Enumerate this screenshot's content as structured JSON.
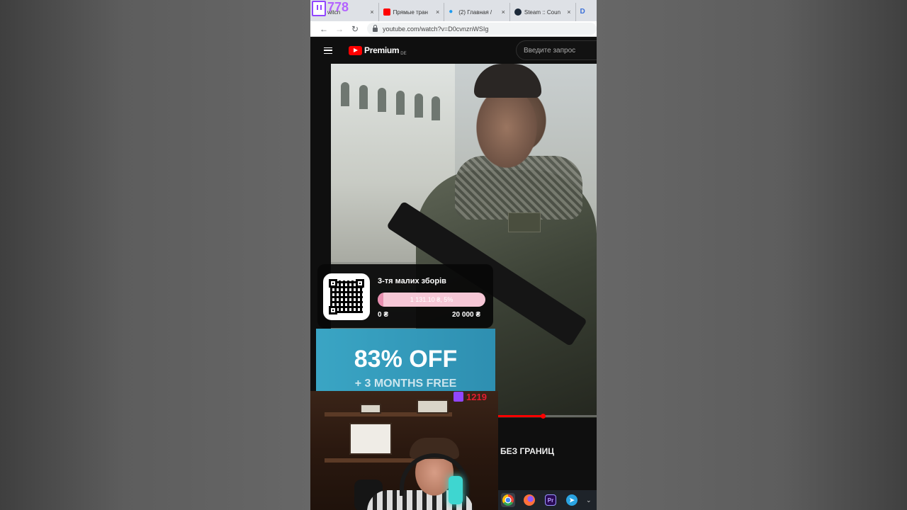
{
  "twitch_overlay": {
    "follower_count": "778"
  },
  "browser": {
    "tabs": [
      {
        "label": "witch",
        "favicon": "twitch-icon",
        "active": false
      },
      {
        "label": "Прямые тран",
        "favicon": "youtube-icon",
        "active": false
      },
      {
        "label": "(2) Главная /",
        "favicon": "twitter-icon",
        "active": false
      },
      {
        "label": "Steam :: Coun",
        "favicon": "steam-icon",
        "active": false
      },
      {
        "label": "D",
        "favicon": "d-icon",
        "active": false
      }
    ],
    "tab_close_glyph": "×",
    "url": "youtube.com/watch?v=D0cvnznWSIg"
  },
  "youtube": {
    "brand": "Premium",
    "country_code": "DE",
    "search_placeholder": "Введите запрос",
    "progress_fraction": 0.45,
    "caption": "БЕЗ ГРАНИЦ"
  },
  "donation_widget": {
    "title": "3-тя малих зборів",
    "progress_text": "1 131.10 ₴, 5%",
    "progress_fraction": 0.05,
    "min_label": "0 ₴",
    "max_label": "20 000 ₴"
  },
  "ad": {
    "headline": "83% OFF",
    "subline": "+ 3 MONTHS FREE",
    "colors": {
      "background": "#3aa5c4"
    }
  },
  "webcam": {
    "viewer_count": "1219",
    "viewer_color": "#e41d2f"
  },
  "taskbar": {
    "items": [
      "chrome-icon",
      "firefox-icon",
      "premiere-icon",
      "telegram-icon"
    ],
    "premiere_label": "Pr",
    "telegram_glyph": "➤",
    "overflow_glyph": "⌄"
  },
  "colors": {
    "twitch": "#9146ff",
    "youtube_red": "#ff0000"
  }
}
